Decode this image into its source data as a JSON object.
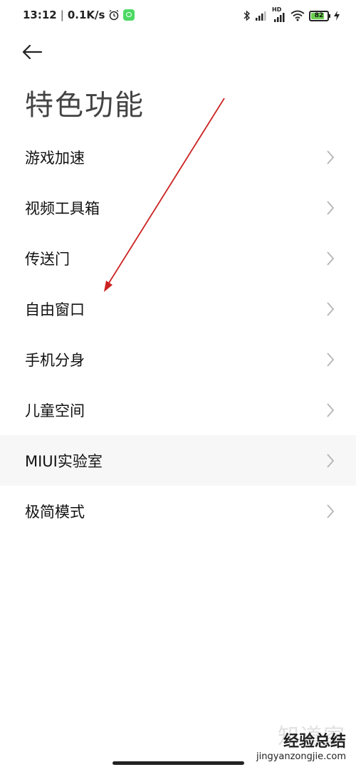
{
  "status_bar": {
    "time": "13:12",
    "separator": "|",
    "speed": "0.1K/s",
    "network_label": "HD",
    "battery": "82",
    "battery_level": 0.82,
    "battery_color": "#6ad04f"
  },
  "header": {
    "title": "特色功能"
  },
  "menu": {
    "items": [
      {
        "label": "游戏加速"
      },
      {
        "label": "视频工具箱"
      },
      {
        "label": "传送门"
      },
      {
        "label": "自由窗口"
      },
      {
        "label": "手机分身"
      },
      {
        "label": "儿童空间"
      },
      {
        "label": "MIUI实验室"
      },
      {
        "label": "极简模式"
      }
    ]
  },
  "watermark": {
    "big": "知道家",
    "mid": "经验总结",
    "url": "jingyanzongjie.com"
  },
  "colors": {
    "annotation_arrow": "#cc2222",
    "chevron": "#b5b5b5"
  }
}
